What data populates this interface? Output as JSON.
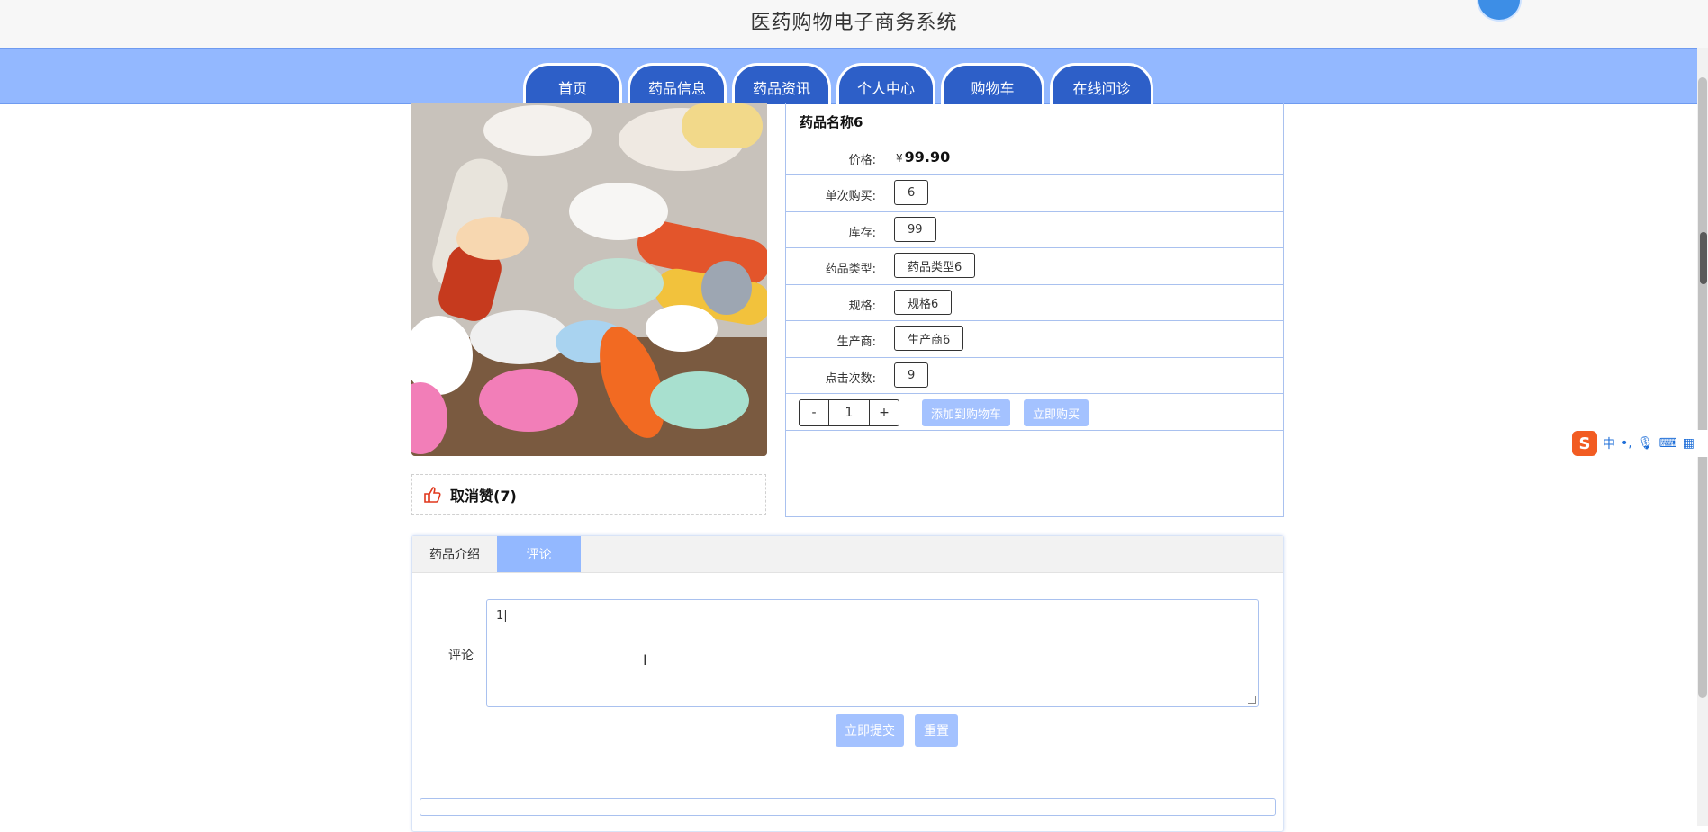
{
  "header": {
    "title": "医药购物电子商务系统"
  },
  "nav": {
    "items": [
      {
        "label": "首页"
      },
      {
        "label": "药品信息"
      },
      {
        "label": "药品资讯"
      },
      {
        "label": "个人中心"
      },
      {
        "label": "购物车"
      },
      {
        "label": "在线问诊"
      }
    ]
  },
  "product": {
    "name": "药品名称6",
    "price_label": "价格:",
    "price_symbol": "¥",
    "price": "99.90",
    "fields": [
      {
        "label": "单次购买:",
        "value": "6"
      },
      {
        "label": "库存:",
        "value": "99"
      },
      {
        "label": "药品类型:",
        "value": "药品类型6"
      },
      {
        "label": "规格:",
        "value": "规格6"
      },
      {
        "label": "生产商:",
        "value": "生产商6"
      },
      {
        "label": "点击次数:",
        "value": "9"
      }
    ],
    "quantity": "1",
    "minus": "-",
    "plus": "+",
    "add_to_cart": "添加到购物车",
    "buy_now": "立即购买"
  },
  "like": {
    "label": "取消赞(7)"
  },
  "tabs": {
    "intro": "药品介绍",
    "comment": "评论"
  },
  "comment_form": {
    "label": "评论",
    "value": "1|",
    "submit": "立即提交",
    "reset": "重置"
  },
  "ime": {
    "logo": "S",
    "mode": "中"
  },
  "colors": {
    "nav_bg": "#93b8ff",
    "nav_tab": "#2d5fc8",
    "button_light": "#a4c2ff",
    "border": "#a9c1ef"
  }
}
